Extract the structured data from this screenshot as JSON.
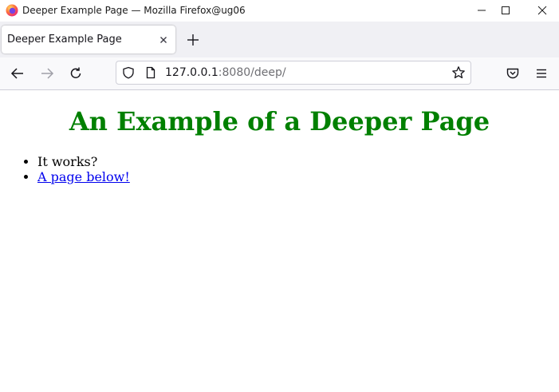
{
  "window": {
    "title": "Deeper Example Page — Mozilla Firefox@ug06"
  },
  "tabs": [
    {
      "label": "Deeper Example Page"
    }
  ],
  "urlbar": {
    "host": "127.0.0.1",
    "rest": ":8080/deep/"
  },
  "page": {
    "heading": "An Example of a Deeper Page",
    "heading_color": "#008000",
    "items": [
      {
        "text": "It works?"
      },
      {
        "text": "A page below!"
      }
    ],
    "link_color": "#0000ee"
  }
}
